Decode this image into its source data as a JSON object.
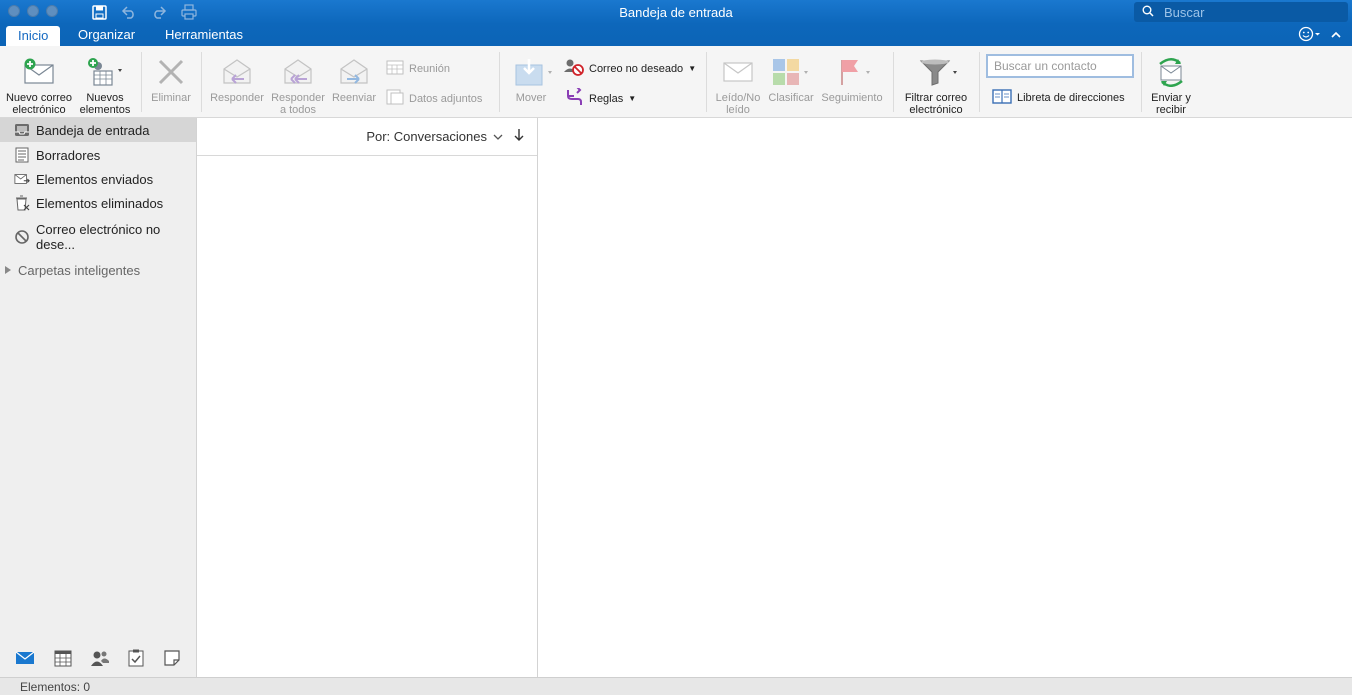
{
  "window": {
    "title": "Bandeja de entrada",
    "search_placeholder": "Buscar"
  },
  "tabs": [
    {
      "label": "Inicio",
      "active": true
    },
    {
      "label": "Organizar"
    },
    {
      "label": "Herramientas"
    }
  ],
  "ribbon": {
    "new_email_l1": "Nuevo correo",
    "new_email_l2": "electrónico",
    "new_items_l1": "Nuevos",
    "new_items_l2": "elementos",
    "delete": "Eliminar",
    "reply": "Responder",
    "reply_all_l1": "Responder",
    "reply_all_l2": "a todos",
    "forward": "Reenviar",
    "meeting": "Reunión",
    "attachments": "Datos adjuntos",
    "move": "Mover",
    "junk": "Correo no deseado",
    "rules": "Reglas",
    "read_unread_l1": "Leído/No",
    "read_unread_l2": "leído",
    "categorize": "Clasificar",
    "follow_up": "Seguimiento",
    "filter_l1": "Filtrar correo",
    "filter_l2": "electrónico",
    "contact_search_placeholder": "Buscar un contacto",
    "address_book": "Libreta de direcciones",
    "send_receive_l1": "Enviar y",
    "send_receive_l2": "recibir"
  },
  "sidebar": {
    "folders": [
      {
        "label": "Bandeja de entrada",
        "icon": "inbox-icon",
        "selected": true
      },
      {
        "label": "Borradores",
        "icon": "drafts-icon"
      },
      {
        "label": "Elementos enviados",
        "icon": "sent-icon"
      },
      {
        "label": "Elementos eliminados",
        "icon": "trash-icon"
      },
      {
        "label": "Correo electrónico no dese...",
        "icon": "junk-icon"
      }
    ],
    "smart_folders": "Carpetas inteligentes"
  },
  "message_list": {
    "sort_label": "Por: Conversaciones"
  },
  "status": {
    "items": "Elementos: 0"
  },
  "colors": {
    "accent": "#0f6cbd",
    "ribbon_bg": "#f5f5f5",
    "sidebar_bg": "#efefef"
  }
}
